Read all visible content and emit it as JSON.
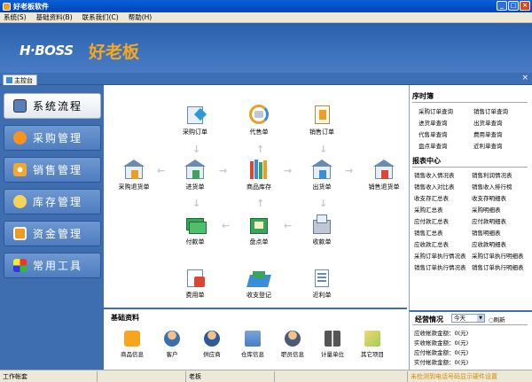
{
  "window": {
    "title": "好老板软件"
  },
  "menu": [
    "系统(S)",
    "基础资料(B)",
    "联系我们(C)",
    "帮助(H)"
  ],
  "brand": {
    "logo_en": "H·BOSS",
    "logo_cn": "好老板"
  },
  "tab": {
    "label": "主控台"
  },
  "nav": [
    {
      "label": "系统流程"
    },
    {
      "label": "采购管理"
    },
    {
      "label": "销售管理"
    },
    {
      "label": "库存管理"
    },
    {
      "label": "资金管理"
    },
    {
      "label": "常用工具"
    }
  ],
  "flow": {
    "caigou_dingdan": "采购订单",
    "daishou": "代售单",
    "xiaoshou_dingdan": "销售订单",
    "caigou_tuihuo": "采购退货单",
    "jinhuo": "进货单",
    "shangpin_kucun": "商品库存",
    "chuhuo": "出货单",
    "xiaoshou_tuihuo": "销售退货单",
    "fukuan": "付款单",
    "pandian": "盘点单",
    "shoukuan": "收款单",
    "feiyong": "费用单",
    "shouzhi": "收支登记",
    "jinli": "近利单"
  },
  "shortcuts": {
    "title": "序时簿",
    "items": [
      "采购订单查询",
      "销售订单查询",
      "进货单查询",
      "出货单查询",
      "代售单查询",
      "费用单查询",
      "盘点单查询",
      "近利单查询"
    ]
  },
  "reports": {
    "title": "报表中心",
    "items": [
      "销售收入情况表",
      "销售利润情况表",
      "销售收入对比表",
      "销售收入排行榜",
      "收支存汇总表",
      "收支存明细表",
      "采购汇总表",
      "采购明细表",
      "应付款汇总表",
      "应付款明细表",
      "销售汇总表",
      "销售明细表",
      "应收款汇总表",
      "应收款明细表",
      "采购订单执行情况表",
      "采购订单执行明细表",
      "销售订单执行情况表",
      "销售订单执行明细表"
    ]
  },
  "basic": {
    "title": "基础资料",
    "items": [
      "商品信息",
      "客户",
      "供应商",
      "仓库信息",
      "职员信息",
      "计量单位",
      "其它项目"
    ]
  },
  "finance": {
    "title": "经营情况",
    "period": "今天",
    "refresh": "刷新",
    "rows": [
      "应收帐款金额：0(元)",
      "实收帐款金额：0(元)",
      "应付帐款金额：0(元)",
      "实付帐款金额：0(元)"
    ]
  },
  "status": {
    "account": "工作帐套",
    "user": "老板",
    "notice": "未检测到电话号码显示硬件设置"
  },
  "colors": {
    "titlebar": "#0343b8",
    "banner": "#2a5fae",
    "brand_cn": "#f8a81e",
    "nav": "#3e6db0"
  }
}
